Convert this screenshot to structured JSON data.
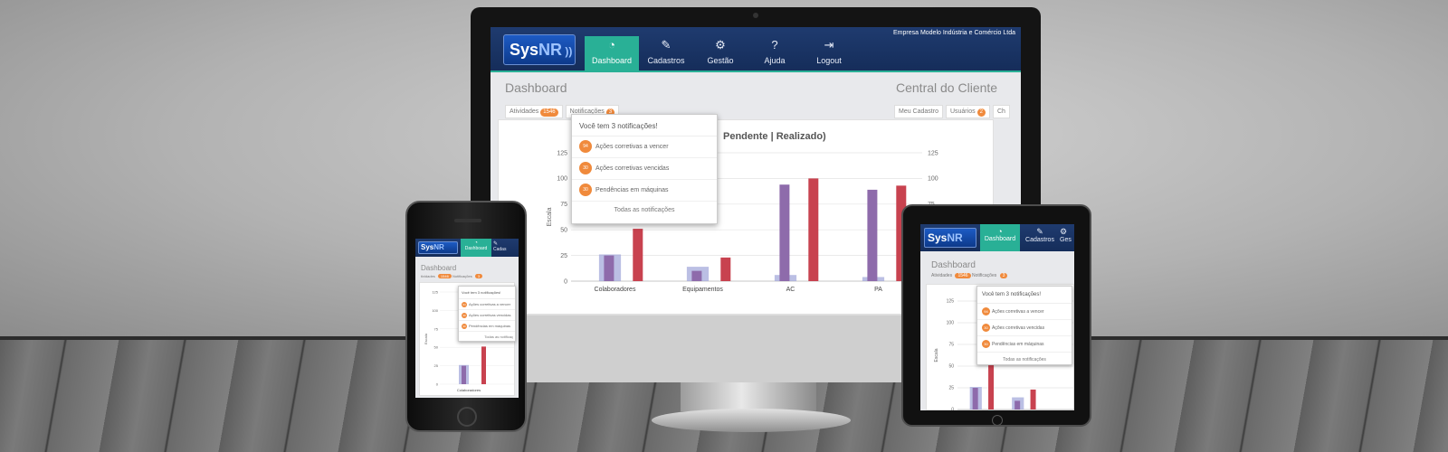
{
  "app": {
    "logo_text_a": "Sys",
    "logo_text_b": "NR",
    "company": "Empresa Modelo Indústria e Comércio Ltda",
    "nav": [
      {
        "label": "Dashboard",
        "icon": "dashboard-gauge-icon"
      },
      {
        "label": "Cadastros",
        "icon": "edit-icon"
      },
      {
        "label": "Gestão",
        "icon": "gear-icon"
      },
      {
        "label": "Ajuda",
        "icon": "help-icon"
      },
      {
        "label": "Logout",
        "icon": "logout-icon"
      }
    ],
    "page_title": "Dashboard",
    "right_title": "Central do Cliente",
    "left_tabs": {
      "atividades": "Atividades",
      "atividades_count": "1546",
      "notificacoes": "Notificações",
      "notificacoes_count": "3"
    },
    "right_tabs": {
      "meu_cadastro": "Meu Cadastro",
      "usuarios": "Usuários",
      "usuarios_count": "2",
      "cut": "Ch"
    },
    "notifications": {
      "header": "Você tem 3 notificações!",
      "items": [
        {
          "count": "94",
          "label": "Ações corretivas a vencer"
        },
        {
          "count": "30",
          "label": "Ações corretivas vencidas"
        },
        {
          "count": "30",
          "label": "Pendências em máquinas"
        }
      ],
      "footer": "Todas as notificações"
    },
    "colors": {
      "primary": "#1f3b6f",
      "accent": "#29b096",
      "badge": "#f08a3c",
      "pendente": "#8e6bab",
      "realizado": "#c8424f",
      "other": "#9ea4d8"
    }
  },
  "chart_data": {
    "type": "bar",
    "title_visible": "Pendente | Realizado)",
    "ylabel": "Escala",
    "ylim": [
      0,
      125
    ],
    "yticks": [
      0,
      25,
      50,
      75,
      100,
      125
    ],
    "categories": [
      "Colaboradores",
      "Equipamentos",
      "AC",
      "PA"
    ],
    "series": [
      {
        "values": [
          26,
          14,
          6,
          4
        ]
      },
      {
        "name": "Pendente",
        "values": [
          25,
          10,
          94,
          89
        ]
      },
      {
        "name": "Realizado",
        "values": [
          51,
          23,
          100,
          93
        ]
      }
    ],
    "grid": true
  },
  "phone": {
    "ylabels": [
      "125",
      "100",
      "75",
      "50",
      "25",
      "0"
    ],
    "category": "Colaboradores",
    "partial_tab_a": "tividades",
    "partial_nav": "Cadas",
    "notif_footer_cut": "Todas as notificaç",
    "notif_item_cut_1": "Ações corretivas a vencer",
    "notif_item_cut_2": "Ações corretivas vencidas",
    "notif_item_cut_3": "Pendências em máquinas"
  },
  "tablet": {
    "partial_nav": "Ges",
    "yticks": [
      "125",
      "100",
      "75",
      "50",
      "25",
      "0"
    ]
  }
}
